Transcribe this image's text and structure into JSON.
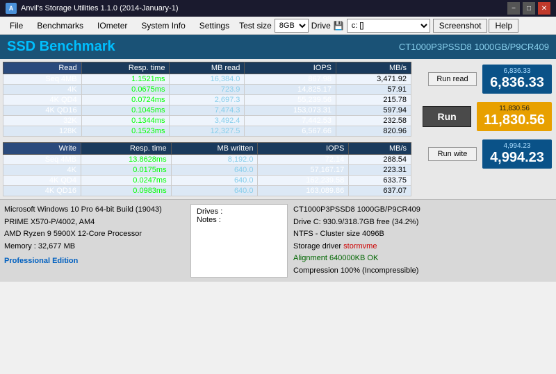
{
  "titlebar": {
    "title": "Anvil's Storage Utilities 1.1.0 (2014-January-1)",
    "controls": [
      "−",
      "□",
      "✕"
    ]
  },
  "menubar": {
    "items": [
      "File",
      "Benchmarks",
      "IOmeter",
      "System Info",
      "Settings"
    ],
    "testsize_label": "Test size",
    "testsize_value": "8GB",
    "drive_label": "Drive",
    "drive_icon": "💾",
    "drive_value": "c: []",
    "screenshot_label": "Screenshot",
    "help_label": "Help"
  },
  "banner": {
    "title": "SSD Benchmark",
    "device": "CT1000P3PSSD8 1000GB/P9CR409"
  },
  "read_table": {
    "headers": [
      "Read",
      "Resp. time",
      "MB read",
      "IOPS",
      "MB/s"
    ],
    "rows": [
      {
        "label": "Seq 4MB",
        "resp": "1.1521ms",
        "mb": "16,384.0",
        "iops": "867.98",
        "mbs": "3,471.92"
      },
      {
        "label": "4K",
        "resp": "0.0675ms",
        "mb": "723.9",
        "iops": "14,825.17",
        "mbs": "57.91"
      },
      {
        "label": "4K QD4",
        "resp": "0.0724ms",
        "mb": "2,697.3",
        "iops": "55,239.56",
        "mbs": "215.78"
      },
      {
        "label": "4K QD16",
        "resp": "0.1045ms",
        "mb": "7,474.3",
        "iops": "153,073.31",
        "mbs": "597.94"
      },
      {
        "label": "32K",
        "resp": "0.1344ms",
        "mb": "3,492.4",
        "iops": "7,442.53",
        "mbs": "232.58"
      },
      {
        "label": "128K",
        "resp": "0.1523ms",
        "mb": "12,327.5",
        "iops": "6,567.66",
        "mbs": "820.96"
      }
    ]
  },
  "write_table": {
    "headers": [
      "Write",
      "Resp. time",
      "MB written",
      "IOPS",
      "MB/s"
    ],
    "rows": [
      {
        "label": "Seq 4MB",
        "resp": "13.8628ms",
        "mb": "8,192.0",
        "iops": "72.14",
        "mbs": "288.54"
      },
      {
        "label": "4K",
        "resp": "0.0175ms",
        "mb": "640.0",
        "iops": "57,167.17",
        "mbs": "223.31"
      },
      {
        "label": "4K QD4",
        "resp": "0.0247ms",
        "mb": "640.0",
        "iops": "162,239.58",
        "mbs": "633.75"
      },
      {
        "label": "4K QD16",
        "resp": "0.0983ms",
        "mb": "640.0",
        "iops": "163,089.86",
        "mbs": "637.07"
      }
    ]
  },
  "scores": {
    "read_small": "6,836.33",
    "read_big": "6,836.33",
    "total_small": "11,830.56",
    "total_big": "11,830.56",
    "write_small": "4,994.23",
    "write_big": "4,994.23"
  },
  "buttons": {
    "run_read": "Run read",
    "run": "Run",
    "run_write": "Run wite"
  },
  "bottom": {
    "sys_info": [
      "Microsoft Windows 10 Pro 64-bit Build (19043)",
      "PRIME X570-P/4002, AM4",
      "AMD Ryzen 9 5900X 12-Core Processor",
      "Memory : 32,677 MB"
    ],
    "professional": "Professional Edition",
    "drives_label": "Drives :",
    "notes_label": "Notes :",
    "drive_info": [
      "CT1000P3PSSD8 1000GB/P9CR409",
      "Drive C: 930.9/318.7GB free (34.2%)",
      "NTFS - Cluster size 4096B",
      "Storage driver  stormvme",
      "",
      "Alignment 640000KB OK",
      "Compression 100% (Incompressible)"
    ],
    "storage_driver_label": "Storage driver",
    "storage_driver_value": "stormvme"
  }
}
